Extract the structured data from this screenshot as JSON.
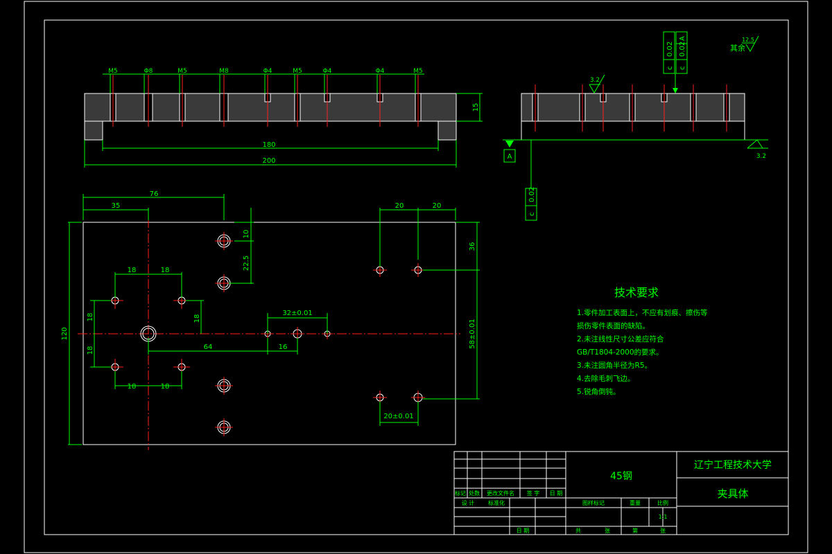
{
  "top_view": {
    "hole_labels": [
      "M5",
      "Φ8",
      "M5",
      "M8",
      "Φ4",
      "M5",
      "Φ4",
      "Φ4",
      "M5"
    ],
    "dims": {
      "inner_length": "180",
      "outer_length": "200",
      "thickness": "15"
    }
  },
  "side_view": {
    "surface_roughness": "3.2",
    "roughness_right": "3.2",
    "datum": "A",
    "tolerance_frame_1": [
      "c",
      "0.02",
      "A"
    ],
    "tolerance_frame_2": [
      "c",
      "0.02"
    ],
    "other_roughness_label": "其余",
    "other_roughness_value": "12.5"
  },
  "plan_view": {
    "dims": {
      "d76": "76",
      "d35": "35",
      "d20a": "20",
      "d20b": "20",
      "d10": "10",
      "d22_5": "22.5",
      "d36": "36",
      "d18_top_l": "18",
      "d18_top_r": "18",
      "d18_left_a": "18",
      "d18_right": "18",
      "d18_left_b": "18",
      "d120": "120",
      "d32": "32±0.01",
      "d64": "64",
      "d16": "16",
      "d58": "58±0.01",
      "d18_bot_l": "18",
      "d18_bot_r": "18",
      "d20_tol": "20±0.01"
    }
  },
  "tech_requirements": {
    "title": "技术要求",
    "items": [
      "1.零件加工表面上，不应有划痕、擦伤等",
      "  损伤零件表面的缺陷。",
      "2.未注线性尺寸公差应符合",
      "  GB/T1804-2000的要求。",
      "3.未注圆角半径为R5。",
      "4.去除毛刺飞边。",
      "5.锐角倒钝。"
    ]
  },
  "title_block": {
    "material": "45钢",
    "university": "辽宁工程技术大学",
    "part_name": "夹具体",
    "scale": "1:1",
    "row_labels": [
      "标记",
      "处数",
      "更改文件名",
      "签 字",
      "日 期"
    ],
    "design_label": "设 计",
    "standard_label": "标准化",
    "stage_header": [
      "图样标记",
      "重量",
      "比例"
    ],
    "audit_labels": [
      "共",
      "张",
      "第",
      "张"
    ],
    "date_label": "日 期"
  }
}
